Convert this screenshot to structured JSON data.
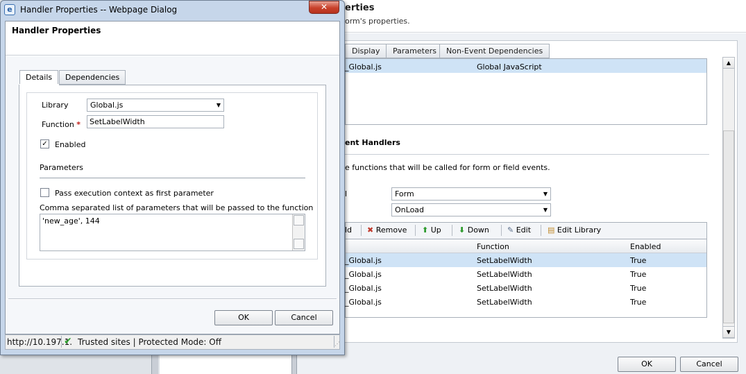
{
  "background_window": {
    "title_partial": "erties",
    "subtitle_partial": "orm's properties.",
    "tabs": [
      "Display",
      "Parameters",
      "Non-Event Dependencies"
    ],
    "libraries": [
      {
        "name_partial": "_Global.js",
        "display_name": "Global JavaScript"
      }
    ],
    "event_handlers_title_partial": "ent Handlers",
    "event_handlers_desc_partial": "e functions that will be called for form or field events.",
    "control_label_partial": "l",
    "control_select": "Form",
    "event_select": "OnLoad",
    "toolbar": {
      "add_partial": "ld",
      "remove": "Remove",
      "up": "Up",
      "down": "Down",
      "edit": "Edit",
      "edit_library": "Edit Library"
    },
    "grid": {
      "headers": [
        "Function",
        "Enabled"
      ],
      "rows": [
        {
          "library": "_Global.js",
          "function": "SetLabelWidth",
          "enabled": "True"
        },
        {
          "library": "_Global.js",
          "function": "SetLabelWidth",
          "enabled": "True"
        },
        {
          "library": "_Global.js",
          "function": "SetLabelWidth",
          "enabled": "True"
        },
        {
          "library": "_Global.js",
          "function": "SetLabelWidth",
          "enabled": "True"
        }
      ]
    },
    "ok_label": "OK",
    "cancel_label": "Cancel"
  },
  "dialog": {
    "window_title": "Handler Properties -- Webpage Dialog",
    "close_glyph": "✕",
    "heading": "Handler Properties",
    "tabs": [
      "Details",
      "Dependencies"
    ],
    "library_label": "Library",
    "library_value": "Global.js",
    "function_label": "Function",
    "required_mark": "*",
    "function_value": "SetLabelWidth",
    "enabled_label": "Enabled",
    "enabled_checked": "✓",
    "parameters_heading": "Parameters",
    "pass_context_label": "Pass execution context as first parameter",
    "params_desc": "Comma separated list of parameters that will be passed to the function",
    "params_value": "'new_age', 144",
    "ok_label": "OK",
    "cancel_label": "Cancel"
  },
  "status_bar": {
    "url": "http://10.197.1.",
    "zone": "Trusted sites | Protected Mode: Off"
  },
  "colors": {
    "selected_row": "#cfe3f6",
    "dialog_frame": "#c6d6ea",
    "close_button": "#c8412b",
    "required": "#c0201a"
  }
}
